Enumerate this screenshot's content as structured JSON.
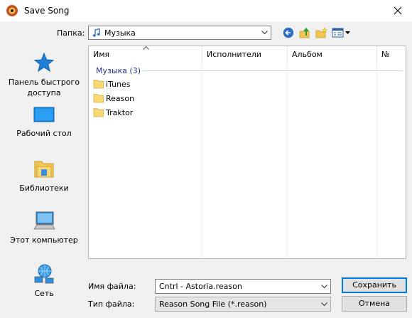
{
  "window": {
    "title": "Save Song",
    "close_icon": "close-icon",
    "app_icon": "reason-app-icon"
  },
  "lookin": {
    "label": "Папка:",
    "value": "Музыка",
    "icon": "music-note-icon"
  },
  "toolbar": {
    "icons": [
      "back-icon",
      "up-folder-icon",
      "new-folder-icon",
      "view-menu-icon"
    ]
  },
  "places": [
    {
      "label": "Панель быстрого доступа",
      "icon": "star-icon"
    },
    {
      "label": "Рабочий стол",
      "icon": "desktop-icon"
    },
    {
      "label": "Библиотеки",
      "icon": "libraries-icon"
    },
    {
      "label": "Этот компьютер",
      "icon": "computer-icon"
    },
    {
      "label": "Сеть",
      "icon": "network-icon"
    }
  ],
  "filelist": {
    "columns": [
      "Имя",
      "Исполнители",
      "Альбом",
      "№"
    ],
    "group": "Музыка (3)",
    "items": [
      {
        "name": "iTunes",
        "icon": "folder-icon"
      },
      {
        "name": "Reason",
        "icon": "folder-icon"
      },
      {
        "name": "Traktor",
        "icon": "folder-icon"
      }
    ]
  },
  "filename": {
    "label": "Имя файла:",
    "value": "Cntrl - Astoria.reason"
  },
  "filetype": {
    "label": "Тип файла:",
    "value": "Reason Song File (*.reason)"
  },
  "buttons": {
    "save": "Сохранить",
    "cancel": "Отмена"
  },
  "colors": {
    "accent": "#0078d7",
    "group_header": "#1e3287",
    "folder": "#f8d775"
  }
}
